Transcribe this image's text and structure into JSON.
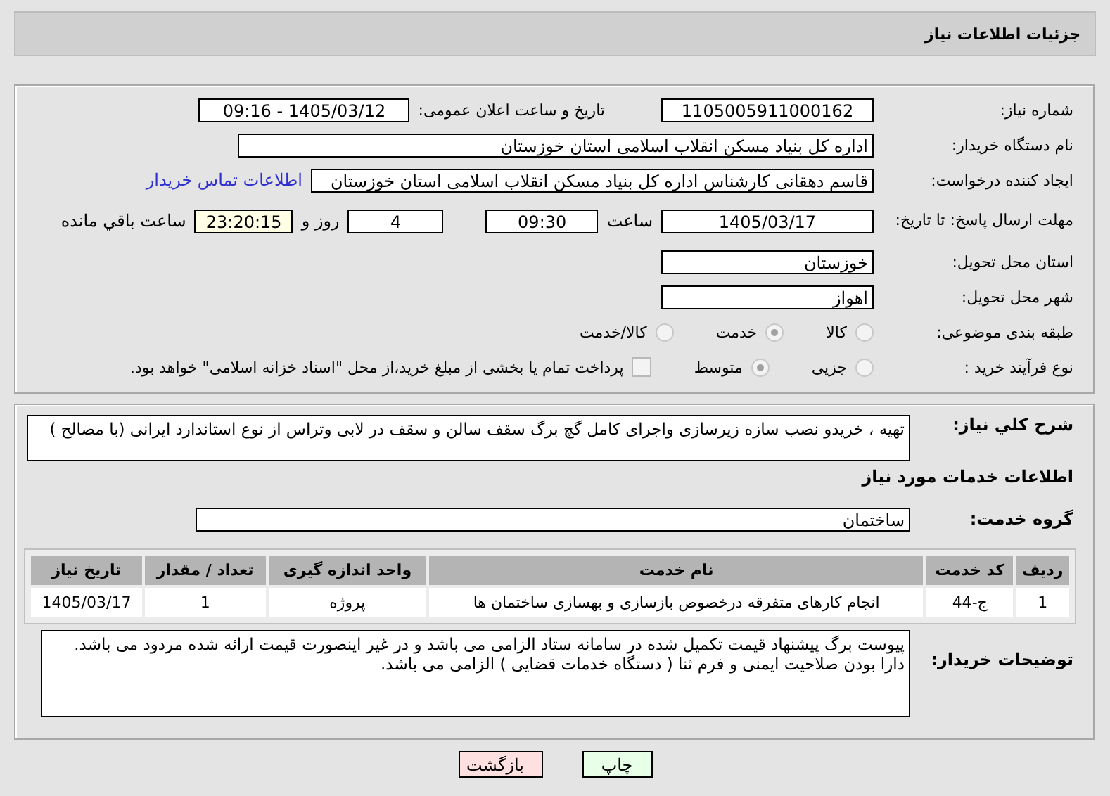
{
  "page_title": "جزئیات اطلاعات نیاز",
  "need_number": {
    "label": "شماره نیاز:",
    "value": "1105005911000162"
  },
  "announce": {
    "label": "تاریخ و ساعت اعلان عمومی:",
    "value": "1405/03/12 - 09:16"
  },
  "buyer": {
    "label": "نام دستگاه خریدار:",
    "value": "اداره کل بنیاد مسکن انقلاب اسلامی استان خوزستان"
  },
  "creator": {
    "label": "ایجاد کننده درخواست:",
    "value": "قاسم دهقانی کارشناس اداره کل بنیاد مسکن انقلاب اسلامی استان خوزستان",
    "link": "اطلاعات تماس خریدار"
  },
  "deadline": {
    "label": "مهلت ارسال پاسخ: تا تاریخ:",
    "date": "1405/03/17",
    "time_label": "ساعت",
    "time": "09:30",
    "days": "4",
    "days_label": "روز و",
    "remaining": "23:20:15",
    "remaining_label": "ساعت باقي مانده"
  },
  "province": {
    "label": "استان محل تحویل:",
    "value": "خوزستان"
  },
  "city": {
    "label": "شهر محل تحویل:",
    "value": "اهواز"
  },
  "category": {
    "label": "طبقه بندی موضوعی:",
    "options": [
      {
        "label": "کالا",
        "selected": false
      },
      {
        "label": "خدمت",
        "selected": true
      },
      {
        "label": "کالا/خدمت",
        "selected": false
      }
    ]
  },
  "purchase_type": {
    "label": "نوع فرآیند خرید :",
    "options": [
      {
        "label": "جزیی",
        "selected": false
      },
      {
        "label": "متوسط",
        "selected": true
      }
    ],
    "payment": {
      "checked": false,
      "text": "پرداخت تمام یا بخشی از مبلغ خرید،از محل \"اسناد خزانه اسلامی\" خواهد بود."
    }
  },
  "description": {
    "label": "شرح کلي نیاز:",
    "value": "تهیه ، خریدو نصب سازه زیرسازی  واجرای کامل گچ برگ سقف سالن  و سقف در لابی وتراس  از نوع استاندارد ایرانی (با مصالح )"
  },
  "services_heading": "اطلاعات خدمات مورد نیاز",
  "service_group": {
    "label": "گروه خدمت:",
    "value": "ساختمان"
  },
  "table": {
    "columns": [
      "ردیف",
      "کد خدمت",
      "نام خدمت",
      "واحد اندازه گیری",
      "تعداد / مقدار",
      "تاریخ نیاز"
    ],
    "rows": [
      [
        "1",
        "ج-44",
        "انجام کارهای متفرقه درخصوص بازسازی و بهسازی ساختمان ها",
        "پروژه",
        "1",
        "1405/03/17"
      ]
    ]
  },
  "buyer_notes": {
    "label": "توضیحات خریدار:",
    "lines": [
      "پیوست برگ پیشنهاد قیمت تکمیل شده در سامانه ستاد الزامی می باشد و در غیر اینصورت  قیمت ارائه شده مردود می باشد.",
      "دارا بودن صلاحیت ایمنی و فرم ثنا ( دستگاه خدمات قضایی ) الزامی می باشد."
    ]
  },
  "buttons": [
    {
      "kind": "print",
      "label": "چاپ"
    },
    {
      "kind": "back",
      "label": "بازگشت"
    }
  ]
}
